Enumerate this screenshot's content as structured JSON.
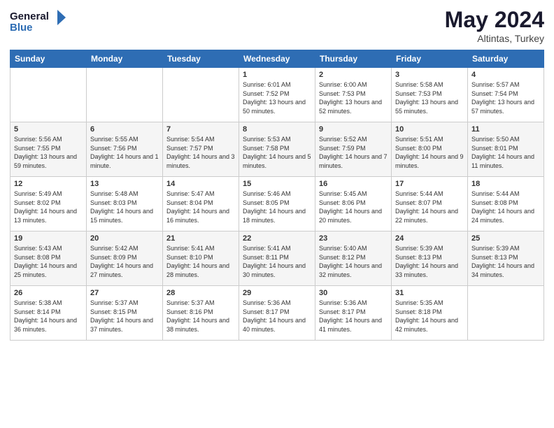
{
  "header": {
    "logo_line1": "General",
    "logo_line2": "Blue",
    "month_year": "May 2024",
    "location": "Altintas, Turkey"
  },
  "days_of_week": [
    "Sunday",
    "Monday",
    "Tuesday",
    "Wednesday",
    "Thursday",
    "Friday",
    "Saturday"
  ],
  "weeks": [
    [
      {
        "day": "",
        "sunrise": "",
        "sunset": "",
        "daylight": ""
      },
      {
        "day": "",
        "sunrise": "",
        "sunset": "",
        "daylight": ""
      },
      {
        "day": "",
        "sunrise": "",
        "sunset": "",
        "daylight": ""
      },
      {
        "day": "1",
        "sunrise": "Sunrise: 6:01 AM",
        "sunset": "Sunset: 7:52 PM",
        "daylight": "Daylight: 13 hours and 50 minutes."
      },
      {
        "day": "2",
        "sunrise": "Sunrise: 6:00 AM",
        "sunset": "Sunset: 7:53 PM",
        "daylight": "Daylight: 13 hours and 52 minutes."
      },
      {
        "day": "3",
        "sunrise": "Sunrise: 5:58 AM",
        "sunset": "Sunset: 7:53 PM",
        "daylight": "Daylight: 13 hours and 55 minutes."
      },
      {
        "day": "4",
        "sunrise": "Sunrise: 5:57 AM",
        "sunset": "Sunset: 7:54 PM",
        "daylight": "Daylight: 13 hours and 57 minutes."
      }
    ],
    [
      {
        "day": "5",
        "sunrise": "Sunrise: 5:56 AM",
        "sunset": "Sunset: 7:55 PM",
        "daylight": "Daylight: 13 hours and 59 minutes."
      },
      {
        "day": "6",
        "sunrise": "Sunrise: 5:55 AM",
        "sunset": "Sunset: 7:56 PM",
        "daylight": "Daylight: 14 hours and 1 minute."
      },
      {
        "day": "7",
        "sunrise": "Sunrise: 5:54 AM",
        "sunset": "Sunset: 7:57 PM",
        "daylight": "Daylight: 14 hours and 3 minutes."
      },
      {
        "day": "8",
        "sunrise": "Sunrise: 5:53 AM",
        "sunset": "Sunset: 7:58 PM",
        "daylight": "Daylight: 14 hours and 5 minutes."
      },
      {
        "day": "9",
        "sunrise": "Sunrise: 5:52 AM",
        "sunset": "Sunset: 7:59 PM",
        "daylight": "Daylight: 14 hours and 7 minutes."
      },
      {
        "day": "10",
        "sunrise": "Sunrise: 5:51 AM",
        "sunset": "Sunset: 8:00 PM",
        "daylight": "Daylight: 14 hours and 9 minutes."
      },
      {
        "day": "11",
        "sunrise": "Sunrise: 5:50 AM",
        "sunset": "Sunset: 8:01 PM",
        "daylight": "Daylight: 14 hours and 11 minutes."
      }
    ],
    [
      {
        "day": "12",
        "sunrise": "Sunrise: 5:49 AM",
        "sunset": "Sunset: 8:02 PM",
        "daylight": "Daylight: 14 hours and 13 minutes."
      },
      {
        "day": "13",
        "sunrise": "Sunrise: 5:48 AM",
        "sunset": "Sunset: 8:03 PM",
        "daylight": "Daylight: 14 hours and 15 minutes."
      },
      {
        "day": "14",
        "sunrise": "Sunrise: 5:47 AM",
        "sunset": "Sunset: 8:04 PM",
        "daylight": "Daylight: 14 hours and 16 minutes."
      },
      {
        "day": "15",
        "sunrise": "Sunrise: 5:46 AM",
        "sunset": "Sunset: 8:05 PM",
        "daylight": "Daylight: 14 hours and 18 minutes."
      },
      {
        "day": "16",
        "sunrise": "Sunrise: 5:45 AM",
        "sunset": "Sunset: 8:06 PM",
        "daylight": "Daylight: 14 hours and 20 minutes."
      },
      {
        "day": "17",
        "sunrise": "Sunrise: 5:44 AM",
        "sunset": "Sunset: 8:07 PM",
        "daylight": "Daylight: 14 hours and 22 minutes."
      },
      {
        "day": "18",
        "sunrise": "Sunrise: 5:44 AM",
        "sunset": "Sunset: 8:08 PM",
        "daylight": "Daylight: 14 hours and 24 minutes."
      }
    ],
    [
      {
        "day": "19",
        "sunrise": "Sunrise: 5:43 AM",
        "sunset": "Sunset: 8:08 PM",
        "daylight": "Daylight: 14 hours and 25 minutes."
      },
      {
        "day": "20",
        "sunrise": "Sunrise: 5:42 AM",
        "sunset": "Sunset: 8:09 PM",
        "daylight": "Daylight: 14 hours and 27 minutes."
      },
      {
        "day": "21",
        "sunrise": "Sunrise: 5:41 AM",
        "sunset": "Sunset: 8:10 PM",
        "daylight": "Daylight: 14 hours and 28 minutes."
      },
      {
        "day": "22",
        "sunrise": "Sunrise: 5:41 AM",
        "sunset": "Sunset: 8:11 PM",
        "daylight": "Daylight: 14 hours and 30 minutes."
      },
      {
        "day": "23",
        "sunrise": "Sunrise: 5:40 AM",
        "sunset": "Sunset: 8:12 PM",
        "daylight": "Daylight: 14 hours and 32 minutes."
      },
      {
        "day": "24",
        "sunrise": "Sunrise: 5:39 AM",
        "sunset": "Sunset: 8:13 PM",
        "daylight": "Daylight: 14 hours and 33 minutes."
      },
      {
        "day": "25",
        "sunrise": "Sunrise: 5:39 AM",
        "sunset": "Sunset: 8:13 PM",
        "daylight": "Daylight: 14 hours and 34 minutes."
      }
    ],
    [
      {
        "day": "26",
        "sunrise": "Sunrise: 5:38 AM",
        "sunset": "Sunset: 8:14 PM",
        "daylight": "Daylight: 14 hours and 36 minutes."
      },
      {
        "day": "27",
        "sunrise": "Sunrise: 5:37 AM",
        "sunset": "Sunset: 8:15 PM",
        "daylight": "Daylight: 14 hours and 37 minutes."
      },
      {
        "day": "28",
        "sunrise": "Sunrise: 5:37 AM",
        "sunset": "Sunset: 8:16 PM",
        "daylight": "Daylight: 14 hours and 38 minutes."
      },
      {
        "day": "29",
        "sunrise": "Sunrise: 5:36 AM",
        "sunset": "Sunset: 8:17 PM",
        "daylight": "Daylight: 14 hours and 40 minutes."
      },
      {
        "day": "30",
        "sunrise": "Sunrise: 5:36 AM",
        "sunset": "Sunset: 8:17 PM",
        "daylight": "Daylight: 14 hours and 41 minutes."
      },
      {
        "day": "31",
        "sunrise": "Sunrise: 5:35 AM",
        "sunset": "Sunset: 8:18 PM",
        "daylight": "Daylight: 14 hours and 42 minutes."
      },
      {
        "day": "",
        "sunrise": "",
        "sunset": "",
        "daylight": ""
      }
    ]
  ]
}
